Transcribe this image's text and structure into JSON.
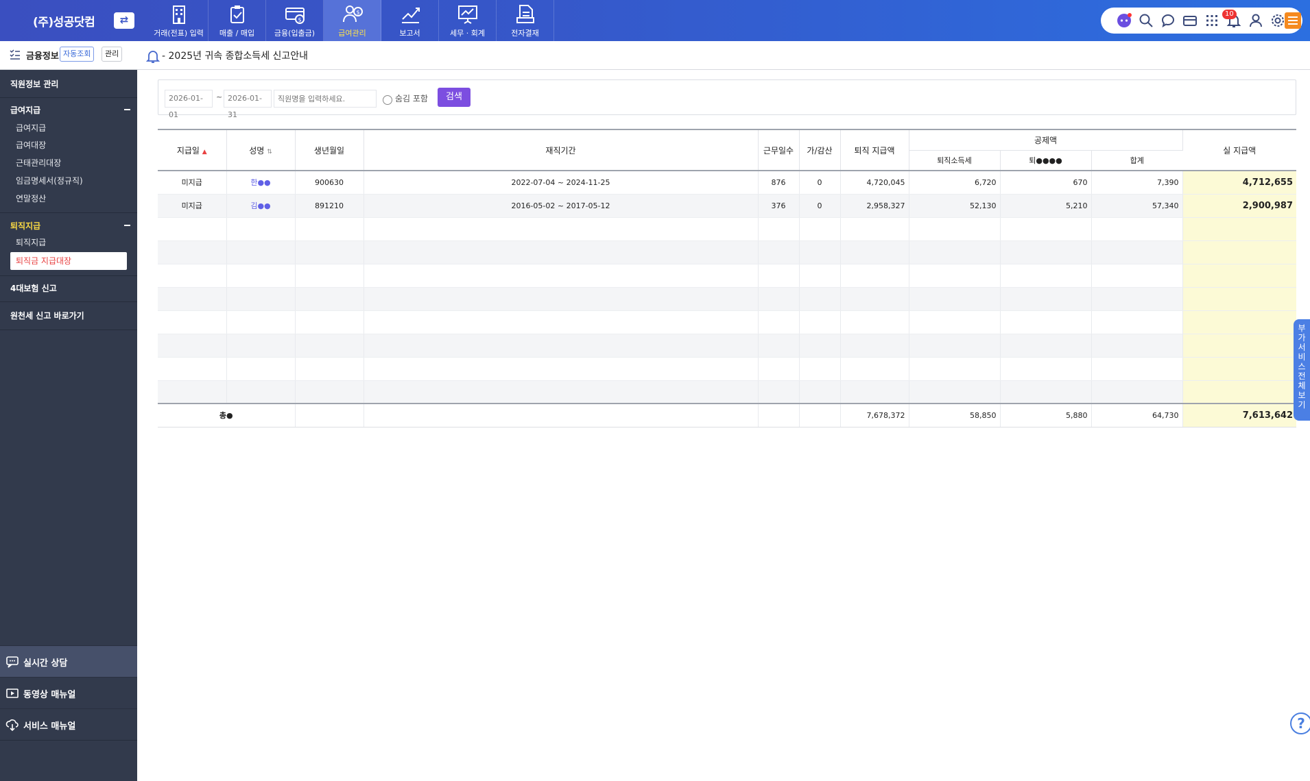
{
  "app": {
    "company": "(주)성공닷컴",
    "switch_icon": "⇄"
  },
  "nav": {
    "items": [
      {
        "label": "거래(전표) 입력",
        "icon": "building-icon"
      },
      {
        "label": "매출 / 매입",
        "icon": "clipboard-icon"
      },
      {
        "label": "금융(입출금)",
        "icon": "money-icon"
      },
      {
        "label": "급여관리",
        "icon": "payroll-icon",
        "active": true
      },
      {
        "label": "보고서",
        "icon": "chart-icon"
      },
      {
        "label": "세무 · 회계",
        "icon": "presentation-icon"
      },
      {
        "label": "전자결재",
        "icon": "document-icon"
      }
    ],
    "notification_count": "10"
  },
  "subheader": {
    "finance_label": "금융정보",
    "auto_lookup": "자동조회",
    "manage": "관리",
    "notice": "- 2025년 귀속 종합소득세 신고안내"
  },
  "sidebar": {
    "employee_info": "직원정보 관리",
    "salary_group": "급여지급",
    "salary_items": [
      "급여지급",
      "급여대장",
      "근태관리대장",
      "임금명세서(정규직)",
      "연말정산"
    ],
    "retire_group": "퇴직지급",
    "retire_items": [
      "퇴직지급",
      "퇴직금 지급대장"
    ],
    "insurance": "4대보험 신고",
    "withholding": "원천세 신고 바로가기",
    "bottom": [
      "실시간 상담",
      "동영상 매뉴얼",
      "서비스 매뉴얼"
    ]
  },
  "search": {
    "date_from": "2026-01-01",
    "tilde": "~",
    "date_to": "2026-01-31",
    "name_placeholder": "직원명을 입력하세요.",
    "hidden_label": "숨김 포함",
    "button": "검색"
  },
  "table": {
    "headers": {
      "pay_date": "지급일",
      "name": "성명",
      "birth": "생년월일",
      "period": "재직기간",
      "work_days": "근무일수",
      "adjust": "가/감산",
      "retire_pay": "퇴직 지급액",
      "deduction": "공제액",
      "retire_income_tax": "퇴직소득세",
      "local_tax": "퇴●●●●",
      "sum": "합계",
      "net_pay": "실 지급액"
    },
    "rows": [
      {
        "pay_date": "미지급",
        "name": "한●●",
        "birth": "900630",
        "period": "2022-07-04 ~ 2024-11-25",
        "work_days": "876",
        "adjust": "0",
        "retire_pay": "4,720,045",
        "tax": "6,720",
        "local": "670",
        "sum": "7,390",
        "net": "4,712,655"
      },
      {
        "pay_date": "미지급",
        "name": "김●●",
        "birth": "891210",
        "period": "2016-05-02 ~ 2017-05-12",
        "work_days": "376",
        "adjust": "0",
        "retire_pay": "2,958,327",
        "tax": "52,130",
        "local": "5,210",
        "sum": "57,340",
        "net": "2,900,987"
      }
    ],
    "total": {
      "label": "총●",
      "retire_pay": "7,678,372",
      "tax": "58,850",
      "local": "5,880",
      "sum": "64,730",
      "net": "7,613,642"
    }
  },
  "side_tab": "부가서비스 전체보기",
  "help": "?"
}
